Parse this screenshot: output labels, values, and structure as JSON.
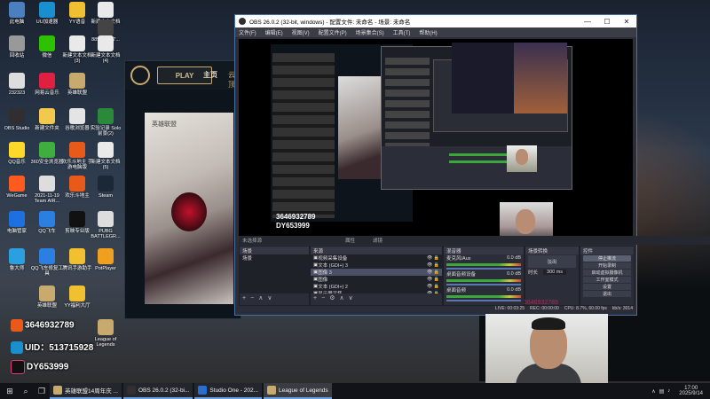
{
  "desktop": {
    "icons": [
      {
        "label": "此电脑",
        "color": "#4a7fc0",
        "pos": "a"
      },
      {
        "label": "UU加速器",
        "color": "#1a8fd0",
        "pos": "b"
      },
      {
        "label": "YY语音",
        "color": "#f0c030",
        "pos": "c"
      },
      {
        "label": "新建文本文档 (2)",
        "color": "#e9e9e9",
        "pos": "d"
      },
      {
        "label": "889164ce7...",
        "color": "#444",
        "pos": "e"
      },
      {
        "label": "回收站",
        "color": "#999",
        "pos": "f"
      },
      {
        "label": "微信",
        "color": "#2dc100",
        "pos": "g"
      },
      {
        "label": "新建文本文档 (3)",
        "color": "#e9e9e9",
        "pos": "h"
      },
      {
        "label": "新建文本文档 (4)",
        "color": "#e9e9e9",
        "pos": "i"
      },
      {
        "label": "232323",
        "color": "#ddd",
        "pos": "j"
      },
      {
        "label": "网易云音乐",
        "color": "#e02040",
        "pos": "k"
      },
      {
        "label": "英雄联盟",
        "color": "#c8aa6e",
        "pos": "l"
      },
      {
        "label": "OBS Studio",
        "color": "#302e31",
        "pos": "m"
      },
      {
        "label": "新建文件夹",
        "color": "#f2c94c",
        "pos": "n"
      },
      {
        "label": "谷歌浏览器",
        "color": "#e4e4e4",
        "pos": "o"
      },
      {
        "label": "实验记录 Solo前景(2)",
        "color": "#2a8a3a",
        "pos": "p"
      },
      {
        "label": "QQ音乐",
        "color": "#ffd92a",
        "pos": "q"
      },
      {
        "label": "360安全浏览器",
        "color": "#3fae3f",
        "pos": "r"
      },
      {
        "label": "欢乐斗地主 手游电脑版",
        "color": "#e85a1a",
        "pos": "s"
      },
      {
        "label": "新建文本文档 (5)",
        "color": "#e9e9e9",
        "pos": "t"
      },
      {
        "label": "WeGame",
        "color": "#ff5a1f",
        "pos": "u"
      },
      {
        "label": "2021-11-19 Team AIR...",
        "color": "#ddd",
        "pos": "v"
      },
      {
        "label": "欢乐斗地主",
        "color": "#e85a1a",
        "pos": "w"
      },
      {
        "label": "Steam",
        "color": "#1b2838",
        "pos": "x"
      },
      {
        "label": "电脑管家",
        "color": "#1e6fe0",
        "pos": "y"
      },
      {
        "label": "QQ飞车",
        "color": "#2a7fe0",
        "pos": "z"
      },
      {
        "label": "剪映专业版",
        "color": "#111",
        "pos": "aa"
      },
      {
        "label": "PUBG BATTLEGR...",
        "color": "#ddd",
        "pos": "ab"
      },
      {
        "label": "鲁大师",
        "color": "#2aa0e0",
        "pos": "ac"
      },
      {
        "label": "QQ飞车修复工具",
        "color": "#2a7fe0",
        "pos": "ad"
      },
      {
        "label": "腾讯手游助手",
        "color": "#f0c030",
        "pos": "ae"
      },
      {
        "label": "PotPlayer",
        "color": "#f0a020",
        "pos": "af"
      },
      {
        "label": "YY福利大厅",
        "color": "#f0c030",
        "pos": "ag"
      },
      {
        "label": "英雄联盟",
        "color": "#c8aa6e",
        "pos": "ah"
      },
      {
        "label": "League of Legends",
        "color": "#c8aa6e",
        "pos": "ai"
      }
    ],
    "overlay": {
      "qq": "3646932789",
      "uid": "UID：513715928",
      "douyin": "DY653999"
    }
  },
  "lol_client": {
    "play": "PLAY",
    "home": "主页",
    "cloud": "云顶",
    "art_title": "英雄联盟"
  },
  "obs": {
    "title": "OBS 26.0.2 (32-bit, windows) - 配置文件: 未命名 - 场景: 未命名",
    "menu": [
      "文件(F)",
      "编辑(E)",
      "视图(V)",
      "配置文件(P)",
      "场景集合(S)",
      "工具(T)",
      "帮助(H)"
    ],
    "preview_ids": {
      "qq": "3646932789",
      "dy": "DY653999"
    },
    "mode_bar": {
      "properties": "属性",
      "filters": "滤镜"
    },
    "no_source": "未选择源",
    "docks": {
      "scenes": {
        "title": "场景",
        "items": [
          "场景"
        ]
      },
      "sources": {
        "title": "来源",
        "items": [
          "视频采集设备",
          "文本 (GDI+) 3",
          "图像 3",
          "图像",
          "文本 (GDI+) 2",
          "显示器采集"
        ]
      },
      "mixer": {
        "title": "混音器",
        "channels": [
          {
            "name": "麦克风/Aux",
            "db": "0.0 dB"
          },
          {
            "name": "桌面音频设备",
            "db": "0.0 dB"
          },
          {
            "name": "桌面音频",
            "db": "0.0 dB"
          }
        ]
      },
      "transitions": {
        "title": "场景转换",
        "type": "淡出",
        "duration_label": "时长",
        "duration": "300 ms"
      },
      "controls": {
        "title": "控件",
        "buttons": [
          "停止推流",
          "开始录制",
          "启动虚拟摄像机",
          "工作室模式",
          "设置",
          "退出"
        ]
      }
    },
    "status": {
      "live": "LIVE: 00:03:25",
      "rec": "REC: 00:00:00",
      "cpu": "CPU: 8.7%, 60.00 fps",
      "kbps": "kb/s: 3014"
    }
  },
  "watermark": "3646932789",
  "taskbar": {
    "buttons": [
      {
        "label": "英雄联盟14周年庆 ...",
        "color": "#c8aa6e"
      },
      {
        "label": "OBS 26.0.2 (32-bi...",
        "color": "#302e31"
      },
      {
        "label": "Studio One - 202...",
        "color": "#2a6fd0"
      },
      {
        "label": "League of Legends",
        "color": "#c8aa6e",
        "active": true
      }
    ],
    "time": "17:00",
    "date": "2025/9/14"
  }
}
